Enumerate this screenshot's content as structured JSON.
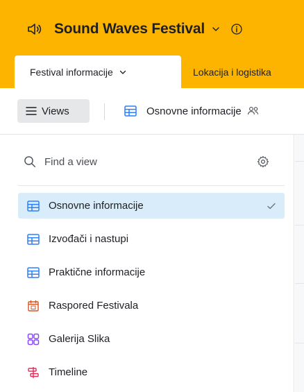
{
  "header": {
    "app_title": "Sound Waves Festival",
    "icons": {
      "app": "speaker-icon",
      "dropdown": "chevron-down-icon",
      "info": "info-icon"
    },
    "bg_color": "#fcb400"
  },
  "tabs": [
    {
      "label": "Festival informacije",
      "active": true
    },
    {
      "label": "Lokacija i logistika",
      "active": false
    }
  ],
  "viewbar": {
    "views_label": "Views",
    "current_view": "Osnovne informacije"
  },
  "view_panel": {
    "search": {
      "placeholder": "Find a view",
      "value": ""
    },
    "views": [
      {
        "label": "Osnovne informacije",
        "icon": "grid-view-icon",
        "color": "#2d7ff9",
        "selected": true
      },
      {
        "label": "Izvođači i nastupi",
        "icon": "grid-view-icon",
        "color": "#2d7ff9",
        "selected": false
      },
      {
        "label": "Praktične informacije",
        "icon": "grid-view-icon",
        "color": "#2d7ff9",
        "selected": false
      },
      {
        "label": "Raspored Festivala",
        "icon": "calendar-view-icon",
        "color": "#d9531e",
        "selected": false
      },
      {
        "label": "Galerija Slika",
        "icon": "gallery-view-icon",
        "color": "#8b46ff",
        "selected": false
      },
      {
        "label": "Timeline",
        "icon": "timeline-view-icon",
        "color": "#e02e5c",
        "selected": false
      }
    ],
    "selected_bg": "#d9ecf9"
  }
}
